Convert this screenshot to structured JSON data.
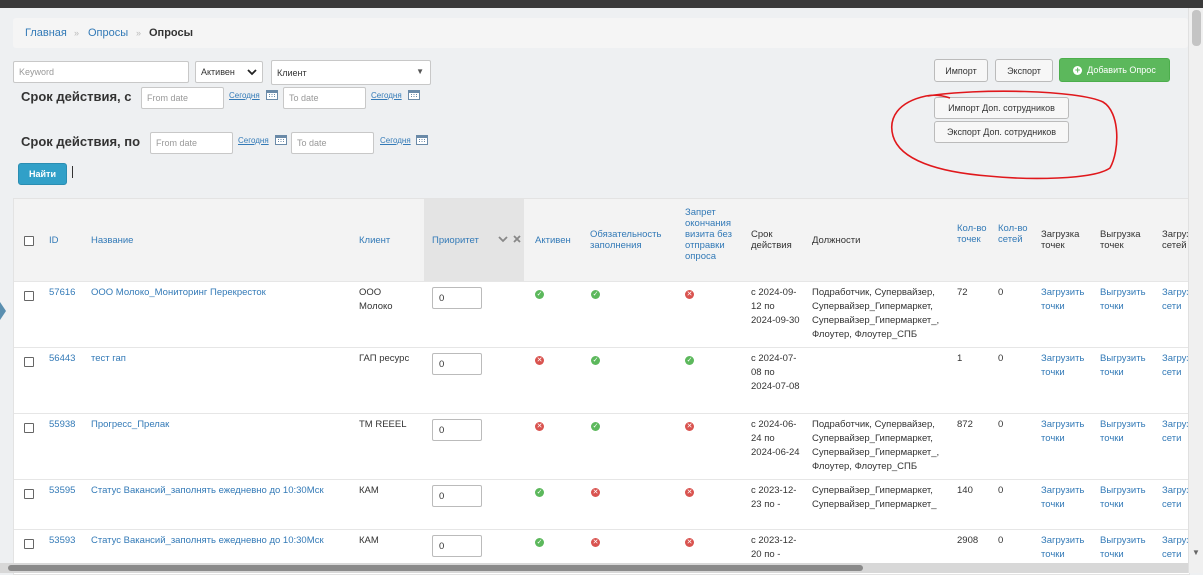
{
  "breadcrumb": {
    "home": "Главная",
    "surveys": "Опросы",
    "current": "Опросы"
  },
  "filters": {
    "keyword_placeholder": "Keyword",
    "status_value": "Активен",
    "client_value": "Клиент",
    "valid_from_label": "Срок действия, с",
    "valid_to_label": "Срок действия, по",
    "from_placeholder": "From date",
    "to_placeholder": "To date",
    "today_label": "Сегодня",
    "find_label": "Найти"
  },
  "actions": {
    "import": "Импорт",
    "export": "Экспорт",
    "add": "Добавить Опрос",
    "import_staff": "Импорт Доп. сотрудников",
    "export_staff": "Экспорт Доп. сотрудников"
  },
  "annotation_color": "#e0181c",
  "table": {
    "headers": {
      "id": "ID",
      "name": "Название",
      "client": "Клиент",
      "priority": "Приоритет",
      "active": "Активен",
      "mandatory": "Обязательность заполнения",
      "ban": "Запрет окончания визита без отправки опроса",
      "period": "Срок действия",
      "positions": "Должности",
      "points_count": "Кол-во точек",
      "networks_count": "Кол-во сетей",
      "upload_points": "Загрузка точек",
      "download_points": "Выгрузка точек",
      "upload_networks": "Загрузка сетей"
    },
    "links": {
      "upload_points": "Загрузить точки",
      "download_points": "Выгрузить точки",
      "upload_networks": "Загрузить сети"
    },
    "rows": [
      {
        "id": "57616",
        "name": "ООО Молоко_Мониторинг Перекресток",
        "client": "ООО Молоко",
        "priority": "0",
        "active": "yes",
        "mandatory": "yes",
        "ban": "no",
        "period": "с 2024-09-12 по 2024-09-30",
        "positions": "Подработчик, Супервайзер, Супервайзер_Гипермаркет, Супервайзер_Гипермаркет_, Флоутер, Флоутер_СПБ",
        "points": "72",
        "networks": "0"
      },
      {
        "id": "56443",
        "name": "тест гап",
        "client": "ГАП ресурс",
        "priority": "0",
        "active": "no",
        "mandatory": "yes",
        "ban": "yes",
        "period": "с 2024-07-08 по 2024-07-08",
        "positions": "",
        "points": "1",
        "networks": "0"
      },
      {
        "id": "55938",
        "name": "Прогресс_Прелак",
        "client": "ТМ REEEL",
        "priority": "0",
        "active": "no",
        "mandatory": "yes",
        "ban": "no",
        "period": "с 2024-06-24 по 2024-06-24",
        "positions": "Подработчик, Супервайзер, Супервайзер_Гипермаркет, Супервайзер_Гипермаркет_, Флоутер, Флоутер_СПБ",
        "points": "872",
        "networks": "0"
      },
      {
        "id": "53595",
        "name": "Статус Ваканcий_заполнять ежедневно до 10:30Мск",
        "client": "КАМ",
        "priority": "0",
        "active": "yes",
        "mandatory": "no",
        "ban": "no",
        "period": "с 2023-12-23 по -",
        "positions": "Супервайзер_Гипермаркет, Супервайзер_Гипермаркет_",
        "points": "140",
        "networks": "0"
      },
      {
        "id": "53593",
        "name": "Статус Ваканcий_заполнять ежедневно до 10:30Мск",
        "client": "КАМ",
        "priority": "0",
        "active": "yes",
        "mandatory": "no",
        "ban": "no",
        "period": "с 2023-12-20 по -",
        "positions": "",
        "points": "2908",
        "networks": "0"
      }
    ]
  }
}
